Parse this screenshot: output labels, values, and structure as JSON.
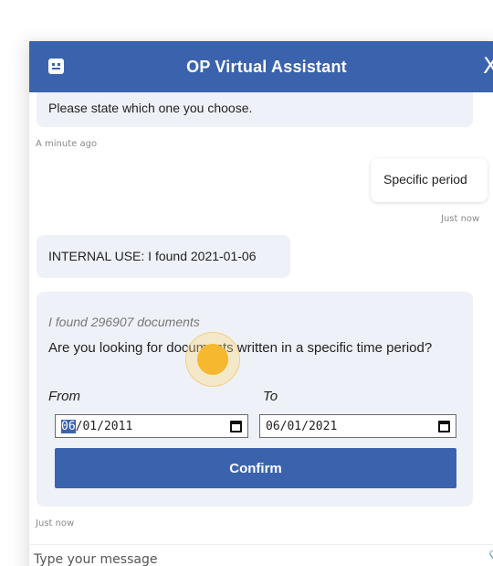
{
  "header": {
    "title": "OP Virtual Assistant",
    "close_label": "X"
  },
  "messages": [
    {
      "text": "Please state which one you choose.",
      "time": "A minute ago"
    },
    {
      "text": "Specific period",
      "time": "Just now"
    },
    {
      "text": "INTERNAL USE: I found 2021-01-06"
    }
  ],
  "card": {
    "found": "I found 296907 documents",
    "question": "Are you looking for documents written in a specific time period?",
    "from_label": "From",
    "to_label": "To",
    "from_month": "06",
    "from_rest": "/01/2011",
    "to_value": "06/01/2021",
    "confirm_label": "Confirm",
    "time": "Just now"
  },
  "composer": {
    "placeholder": "Type your message"
  },
  "colors": {
    "brand": "#3b63ad",
    "bubble": "#eef1f7",
    "cursor": "#f5b82e"
  },
  "icons": {
    "header": "bot-face-icon",
    "close": "close-icon",
    "calendar": "calendar-icon",
    "attach": "attach-icon"
  }
}
